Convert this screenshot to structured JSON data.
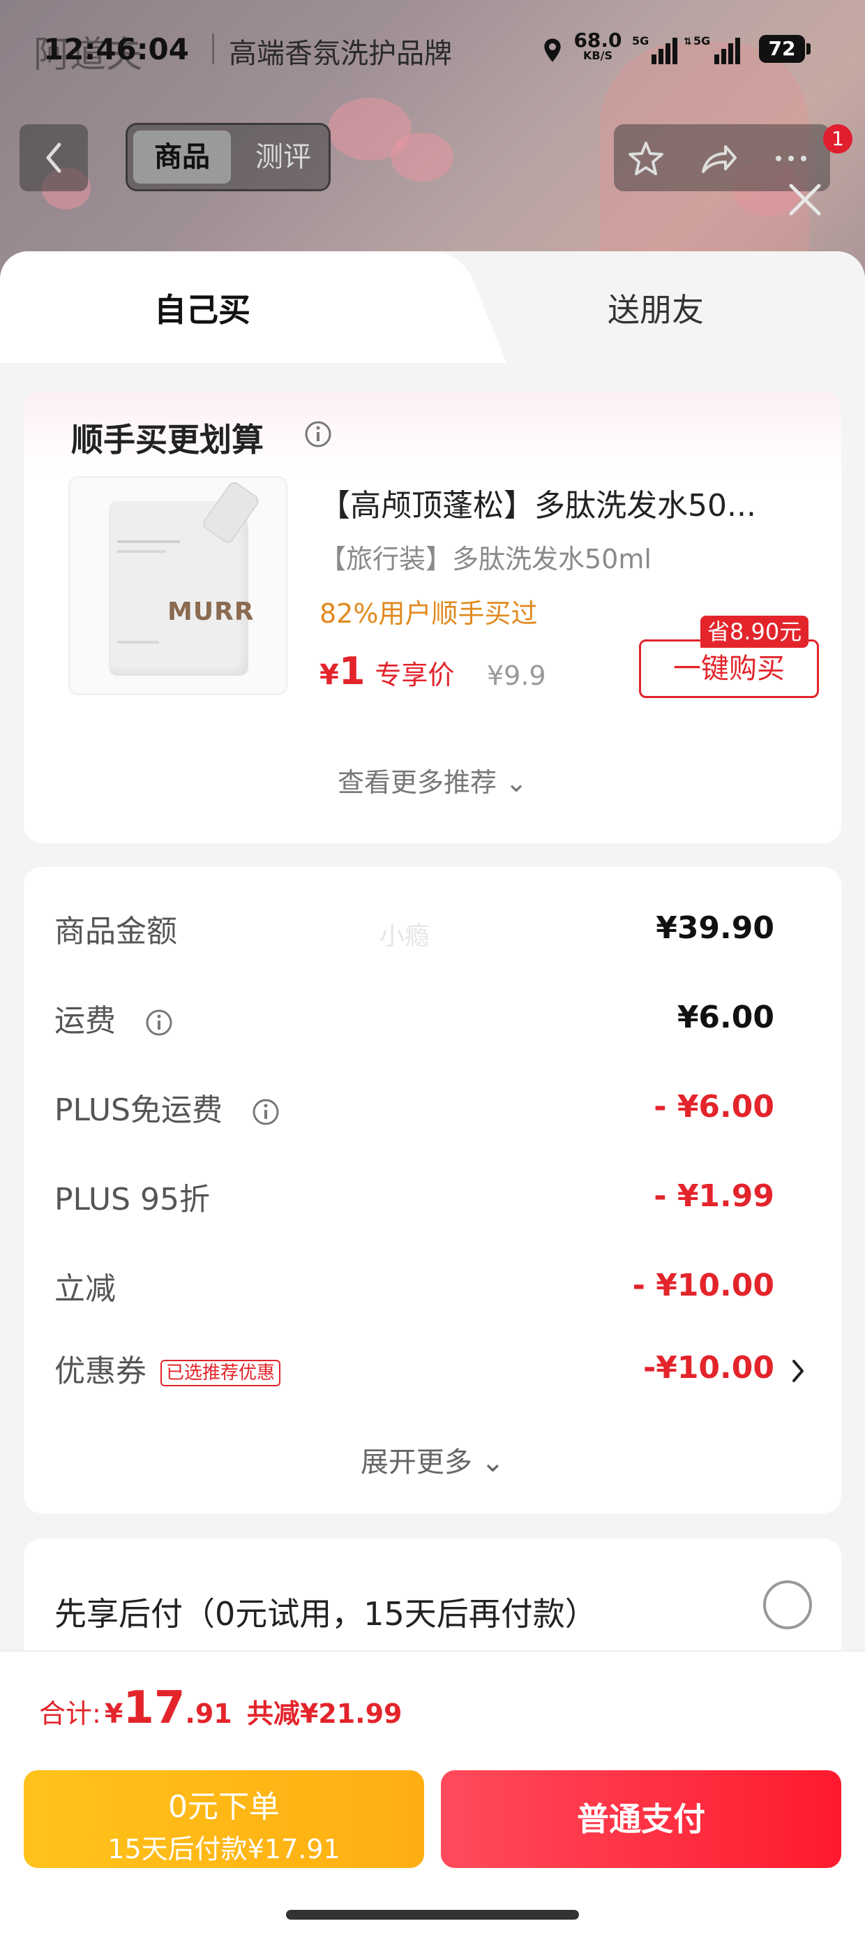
{
  "status_bar": {
    "time": "12:46:04",
    "net_speed": "68.0",
    "net_unit": "KB/S",
    "sim1": "5G",
    "sim2": "5G",
    "battery": "72"
  },
  "background": {
    "brand_name": "阿道夫",
    "brand_desc": "高端香氛洗护品牌"
  },
  "nav": {
    "tab_goods": "商品",
    "tab_review": "测评",
    "badge_count": "1"
  },
  "sheet": {
    "tab_self": "自己买",
    "tab_friend": "送朋友"
  },
  "upsell": {
    "title": "顺手买更划算",
    "product_name": "【高颅顶蓬松】多肽洗发水50...",
    "spec": "【旅行装】多肽洗发水50ml",
    "bought_text": "82%用户顺手买过",
    "price_currency": "¥",
    "price": "1",
    "price_tag": "专享价",
    "original_price": "¥9.9",
    "save_tag": "省8.90元",
    "buy_button": "一键购买",
    "more_link": "查看更多推荐 ⌄",
    "image_brand": "MURR"
  },
  "price_detail": {
    "watermark": "小瘾",
    "rows": [
      {
        "label": "商品金额",
        "value": "¥39.90"
      },
      {
        "label": "运费",
        "value": "¥6.00"
      },
      {
        "label": "PLUS免运费",
        "value": "- ¥6.00"
      },
      {
        "label": "PLUS 95折",
        "value": "- ¥1.99"
      },
      {
        "label": "立减",
        "value": "- ¥10.00"
      },
      {
        "label": "优惠券",
        "value": "-¥10.00",
        "tag": "已选推荐优惠"
      }
    ],
    "expand_more": "展开更多 ⌄"
  },
  "bnpl": {
    "text": "先享后付（0元试用，15天后再付款）"
  },
  "footer": {
    "total_label": "合计:",
    "total_currency": "¥",
    "total_int": "17",
    "total_dec": ".91",
    "total_saved": "共减¥21.99",
    "bnpl_button_line1": "0元下单",
    "bnpl_button_line2": "15天后付款¥17.91",
    "pay_button": "普通支付"
  },
  "colors": {
    "accent_red": "#e3242b",
    "orange_text": "#e08a1e",
    "bnpl_button": "#ffb716",
    "pay_button": "#ff2a3d"
  }
}
